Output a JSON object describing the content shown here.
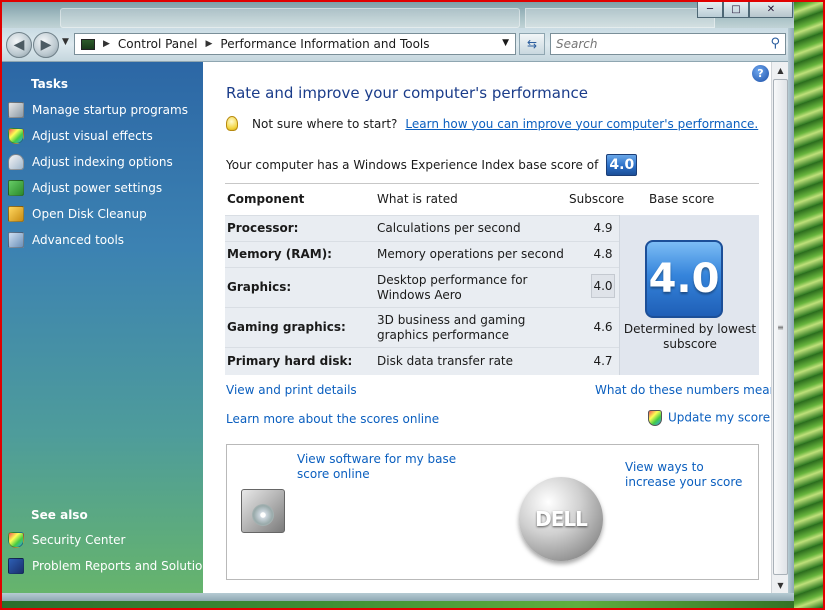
{
  "window": {
    "min_glyph": "─",
    "max_glyph": "□",
    "close_glyph": "✕"
  },
  "nav": {
    "back_glyph": "◀",
    "forward_glyph": "▶",
    "breadcrumb": [
      "Control Panel",
      "Performance Information and Tools"
    ],
    "search_placeholder": "Search"
  },
  "sidebar": {
    "tasks_heading": "Tasks",
    "tasks": [
      {
        "label": "Manage startup programs",
        "icon": "startup-icon"
      },
      {
        "label": "Adjust visual effects",
        "icon": "shield-icon"
      },
      {
        "label": "Adjust indexing options",
        "icon": "indexing-icon"
      },
      {
        "label": "Adjust power settings",
        "icon": "power-icon"
      },
      {
        "label": "Open Disk Cleanup",
        "icon": "disk-cleanup-icon"
      },
      {
        "label": "Advanced tools",
        "icon": "advanced-tools-icon"
      }
    ],
    "see_also_heading": "See also",
    "see_also": [
      {
        "label": "Security Center",
        "icon": "security-center-icon"
      },
      {
        "label": "Problem Reports and Solutions",
        "icon": "problem-reports-icon"
      }
    ]
  },
  "main": {
    "title": "Rate and improve your computer's performance",
    "tip_text": "Not sure where to start?",
    "tip_link": "Learn how you can improve your computer's performance.",
    "wei_text": "Your computer has a Windows Experience Index base score of",
    "base_score": "4.0",
    "table": {
      "headers": [
        "Component",
        "What is rated",
        "Subscore",
        "Base score"
      ],
      "rows": [
        {
          "component": "Processor:",
          "rated": "Calculations per second",
          "subscore": "4.9"
        },
        {
          "component": "Memory (RAM):",
          "rated": "Memory operations per second",
          "subscore": "4.8"
        },
        {
          "component": "Graphics:",
          "rated": "Desktop performance for Windows Aero",
          "subscore": "4.0"
        },
        {
          "component": "Gaming graphics:",
          "rated": "3D business and gaming graphics performance",
          "subscore": "4.6"
        },
        {
          "component": "Primary hard disk:",
          "rated": "Disk data transfer rate",
          "subscore": "4.7"
        }
      ],
      "determined": "Determined by lowest subscore"
    },
    "links": {
      "view_print": "View and print details",
      "what_mean": "What do these numbers mean?",
      "learn_online": "Learn more about the scores online",
      "update": "Update my score"
    },
    "offers": {
      "software": "View software for my base score online",
      "increase": "View ways to increase your score",
      "logo_text": "DELL"
    }
  },
  "colors": {
    "link": "#0b5fbf",
    "title": "#1a3c8a",
    "badge": "#2b6fc7"
  }
}
